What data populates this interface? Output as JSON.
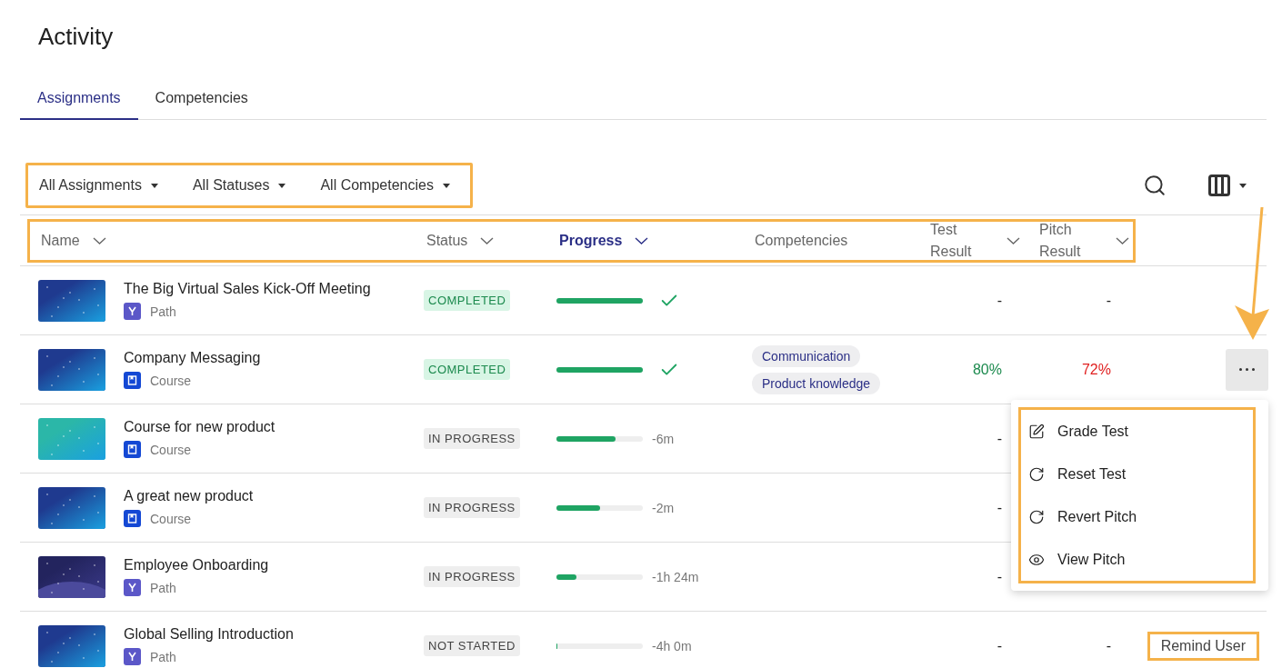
{
  "page": {
    "title": "Activity"
  },
  "tabs": [
    {
      "label": "Assignments",
      "selected": true
    },
    {
      "label": "Competencies",
      "selected": false
    }
  ],
  "filters": {
    "highlighted": true,
    "items": [
      {
        "label": "All Assignments"
      },
      {
        "label": "All Statuses"
      },
      {
        "label": "All Competencies"
      }
    ]
  },
  "toolbar": {
    "search": true,
    "column_picker": true
  },
  "table": {
    "header_highlighted": true,
    "columns": [
      {
        "label": "Name",
        "sortable": true,
        "selected": false
      },
      {
        "label": "Status",
        "sortable": true,
        "selected": false
      },
      {
        "label": "Progress",
        "sortable": true,
        "selected": true
      },
      {
        "label": "Competencies",
        "sortable": false,
        "selected": false
      },
      {
        "label": "Test Result",
        "sortable": true,
        "selected": false
      },
      {
        "label": "Pitch Result",
        "sortable": true,
        "selected": false
      }
    ],
    "rows": [
      {
        "thumbnail": {
          "kind": "picture",
          "color": "#1f3a8f"
        },
        "name": "The Big Virtual Sales Kick-Off Meeting",
        "type": {
          "kind": "path",
          "label": "Path"
        },
        "status": {
          "kind": "completed",
          "label": "COMPLETED"
        },
        "progress": {
          "level": 1,
          "done": true
        },
        "competencies": [],
        "test_result": {
          "text": "-",
          "color": "#222222"
        },
        "pitch_result": {
          "text": "-",
          "color": "#222222"
        }
      },
      {
        "thumbnail": {
          "kind": "picture",
          "color": "#1f3a8f"
        },
        "name": "Company Messaging",
        "type": {
          "kind": "course",
          "label": "Course"
        },
        "status": {
          "kind": "completed",
          "label": "COMPLETED"
        },
        "progress": {
          "level": 1,
          "done": true
        },
        "competencies": [
          "Communication",
          "Product knowledge"
        ],
        "test_result": {
          "text": "80%",
          "color": "#1c8a4e"
        },
        "pitch_result": {
          "text": "72%",
          "color": "#e02020"
        },
        "action": {
          "kind": "more",
          "highlighted": false,
          "expanded": true
        }
      },
      {
        "thumbnail": {
          "kind": "picture",
          "color": "#2bb7a8"
        },
        "name": "Course for new product",
        "type": {
          "kind": "course",
          "label": "Course"
        },
        "status": {
          "kind": "in_progress",
          "label": "IN PROGRESS"
        },
        "progress": {
          "level": 0.68,
          "done": false,
          "remaining": "-6m"
        },
        "competencies": [],
        "test_result": {
          "text": "-",
          "color": "#222222"
        }
      },
      {
        "thumbnail": {
          "kind": "picture",
          "color": "#1f3a8f"
        },
        "name": "A great new product",
        "type": {
          "kind": "course",
          "label": "Course"
        },
        "status": {
          "kind": "in_progress",
          "label": "IN PROGRESS"
        },
        "progress": {
          "level": 0.5,
          "done": false,
          "remaining": "-2m"
        },
        "competencies": [],
        "test_result": {
          "text": "-",
          "color": "#222222"
        }
      },
      {
        "thumbnail": {
          "kind": "picture",
          "color": "#23245e"
        },
        "name": "Employee Onboarding",
        "type": {
          "kind": "path",
          "label": "Path"
        },
        "status": {
          "kind": "in_progress",
          "label": "IN PROGRESS"
        },
        "progress": {
          "level": 0.23,
          "done": false,
          "remaining": "-1h 24m"
        },
        "competencies": [],
        "test_result": {
          "text": "-",
          "color": "#222222"
        }
      },
      {
        "thumbnail": {
          "kind": "picture",
          "color": "#1f3a8f"
        },
        "name": "Global Selling Introduction",
        "type": {
          "kind": "path",
          "label": "Path"
        },
        "status": {
          "kind": "not_started",
          "label": "NOT STARTED"
        },
        "progress": {
          "level": 0,
          "done": false,
          "remaining": "-4h 0m"
        },
        "competencies": [],
        "test_result": {
          "text": "-",
          "color": "#222222"
        },
        "pitch_result": {
          "text": "-",
          "color": "#222222"
        },
        "action": {
          "kind": "remind",
          "label": "Remind User",
          "highlighted": true
        }
      }
    ]
  },
  "menu": {
    "highlighted": true,
    "callout_arrow": true,
    "items": [
      {
        "kind": "edit",
        "label": "Grade Test"
      },
      {
        "kind": "reset",
        "label": "Reset Test"
      },
      {
        "kind": "reset",
        "label": "Revert Pitch"
      },
      {
        "kind": "view",
        "label": "View Pitch"
      }
    ]
  }
}
